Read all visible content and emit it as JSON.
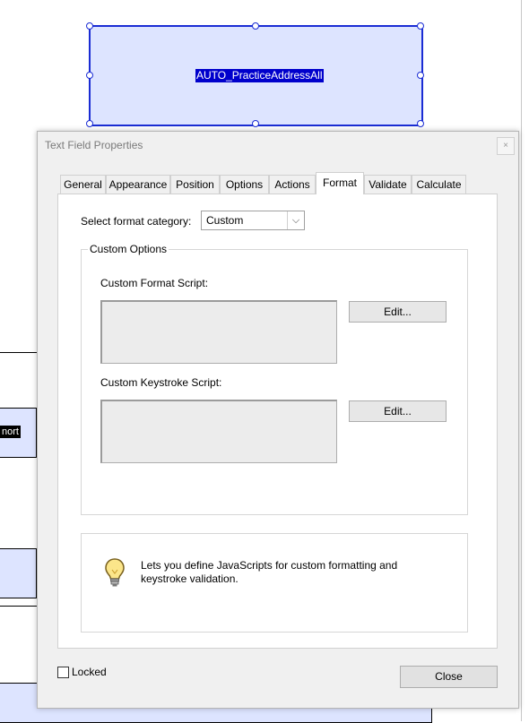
{
  "field": {
    "name": "AUTO_PracticeAddressAll"
  },
  "background": {
    "partial_label": "nort"
  },
  "dialog": {
    "title": "Text Field Properties",
    "close_glyph": "×",
    "tabs": [
      {
        "label": "General"
      },
      {
        "label": "Appearance"
      },
      {
        "label": "Position"
      },
      {
        "label": "Options"
      },
      {
        "label": "Actions"
      },
      {
        "label": "Format",
        "active": true
      },
      {
        "label": "Validate"
      },
      {
        "label": "Calculate"
      }
    ],
    "format_category_label": "Select format category:",
    "format_category_value": "Custom",
    "custom_options_legend": "Custom Options",
    "format_script_label": "Custom Format Script:",
    "keystroke_script_label": "Custom Keystroke Script:",
    "edit_label": "Edit...",
    "tip_text": "Lets you define JavaScripts for custom formatting and keystroke validation.",
    "locked_label": "Locked",
    "locked_checked": false,
    "close_label": "Close"
  },
  "colors": {
    "field_fill": "#dde4ff",
    "selection_border": "#1a2cd4",
    "name_highlight": "#0000cc"
  }
}
